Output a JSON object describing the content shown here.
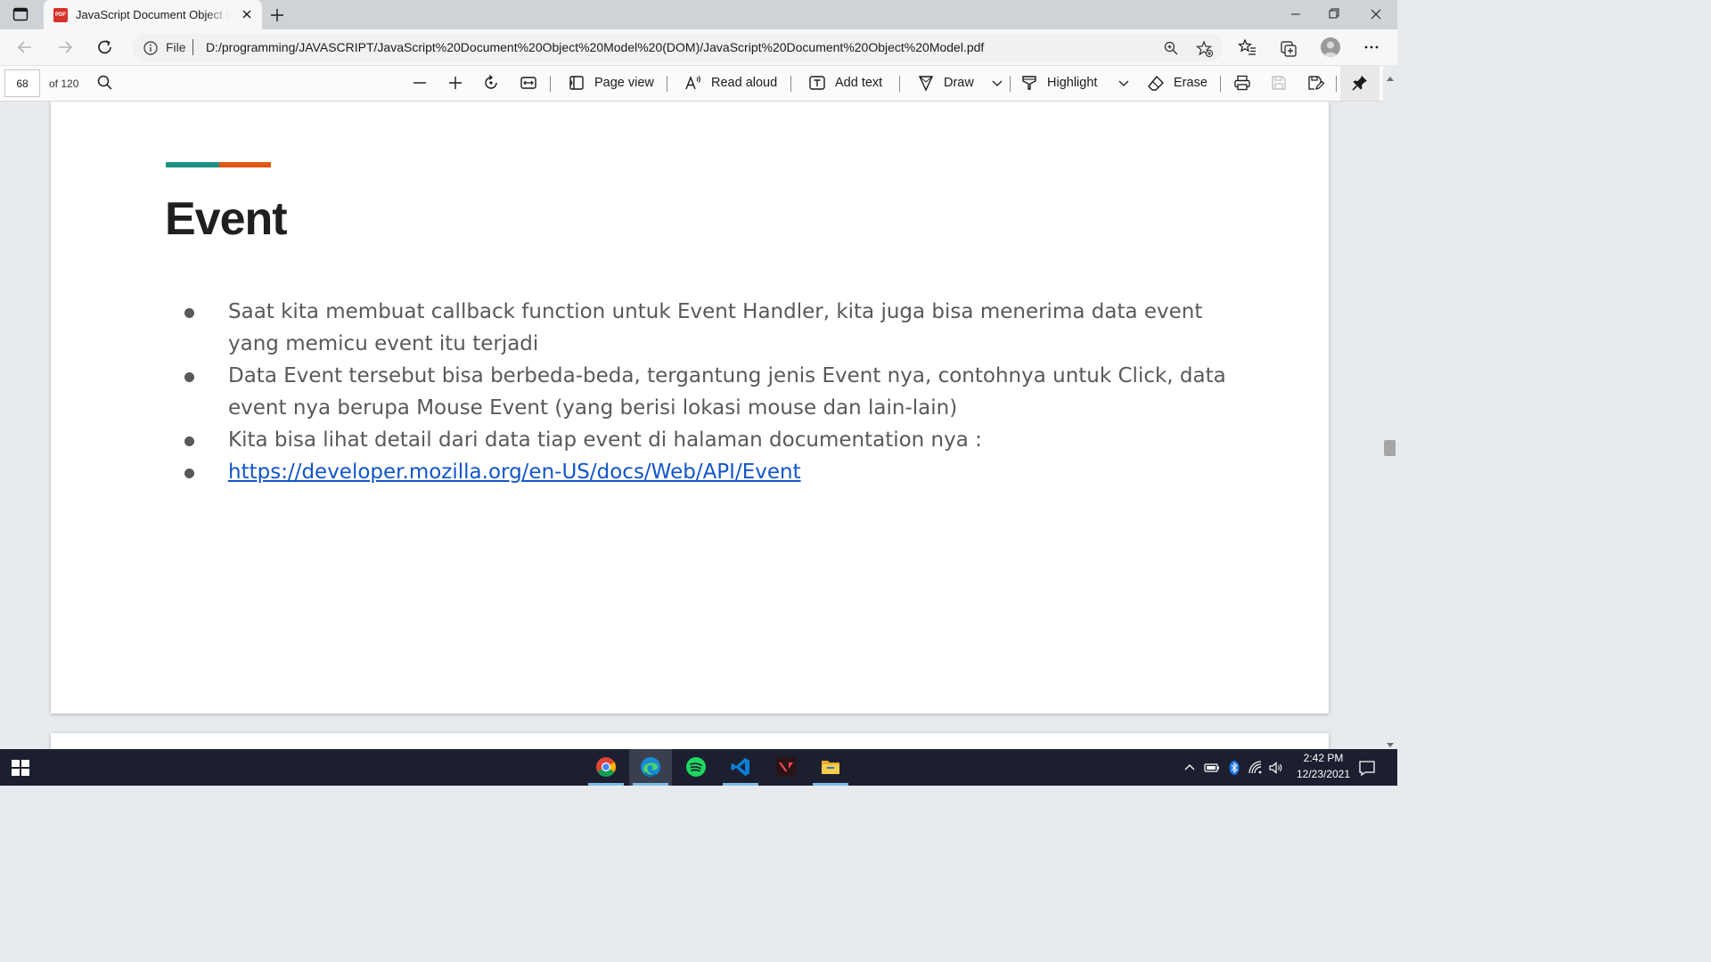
{
  "browser": {
    "tab": {
      "favicon_text": "PDF",
      "title": "JavaScript Document Object Model"
    },
    "address": {
      "site_label": "File",
      "url": "D:/programming/JAVASCRIPT/JavaScript%20Document%20Object%20Model%20(DOM)/JavaScript%20Document%20Object%20Model.pdf"
    }
  },
  "pdf_toolbar": {
    "page_number": "68",
    "page_count": "of 120",
    "page_view_label": "Page view",
    "read_aloud_label": "Read aloud",
    "add_text_label": "Add text",
    "draw_label": "Draw",
    "highlight_label": "Highlight",
    "erase_label": "Erase"
  },
  "document": {
    "title": "Event",
    "bullets": [
      "Saat kita membuat callback function untuk Event Handler, kita juga bisa menerima data event yang memicu event itu terjadi",
      "Data Event tersebut bisa berbeda-beda, tergantung jenis Event nya, contohnya untuk Click, data event nya berupa Mouse Event (yang berisi lokasi mouse dan lain-lain)",
      "Kita bisa lihat detail dari data tiap event di halaman documentation nya :"
    ],
    "link": "https://developer.mozilla.org/en-US/docs/Web/API/Event",
    "colors": {
      "accent_teal": "#1d9383",
      "accent_orange": "#e3560f",
      "link": "#1155cc"
    }
  },
  "taskbar": {
    "apps": [
      "chrome-icon",
      "edge-icon",
      "spotify-icon",
      "vscode-icon",
      "valorant-icon",
      "file-explorer-icon"
    ],
    "active_app": "edge-icon",
    "time": "2:42 PM",
    "date": "12/23/2021"
  }
}
